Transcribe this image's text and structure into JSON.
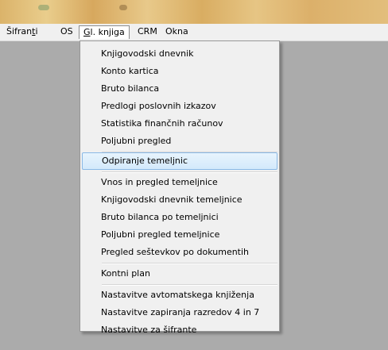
{
  "menubar": {
    "items": [
      {
        "pre": "Šifran",
        "ul": "t",
        "post": "i"
      },
      {
        "pre": "",
        "ul": "",
        "post": "OS"
      },
      {
        "pre": "",
        "ul": "G",
        "post": "l. knjiga"
      },
      {
        "pre": "",
        "ul": "",
        "post": "CRM"
      },
      {
        "pre": "",
        "ul": "",
        "post": "Okna"
      }
    ]
  },
  "dropdown": {
    "items": [
      "Knjigovodski dnevnik",
      "Konto kartica",
      "Bruto bilanca",
      "Predlogi poslovnih izkazov",
      "Statistika finančnih računov",
      "Poljubni pregled",
      "Odpiranje temeljnic",
      "Vnos in pregled temeljnice",
      "Knjigovodski dnevnik temeljnice",
      "Bruto bilanca po temeljnici",
      "Poljubni pregled temeljnice",
      "Pregled seštevkov po dokumentih",
      "Kontni plan",
      "Nastavitve avtomatskega knjiženja",
      "Nastavitve zapiranja razredov 4 in 7",
      "Nastavitve za šifrante"
    ]
  },
  "colors": {
    "workspace": "#ababab",
    "menu_background": "#f0f0f0",
    "highlight_border": "#8ab9e6",
    "titlebar": "#dbb36a"
  }
}
